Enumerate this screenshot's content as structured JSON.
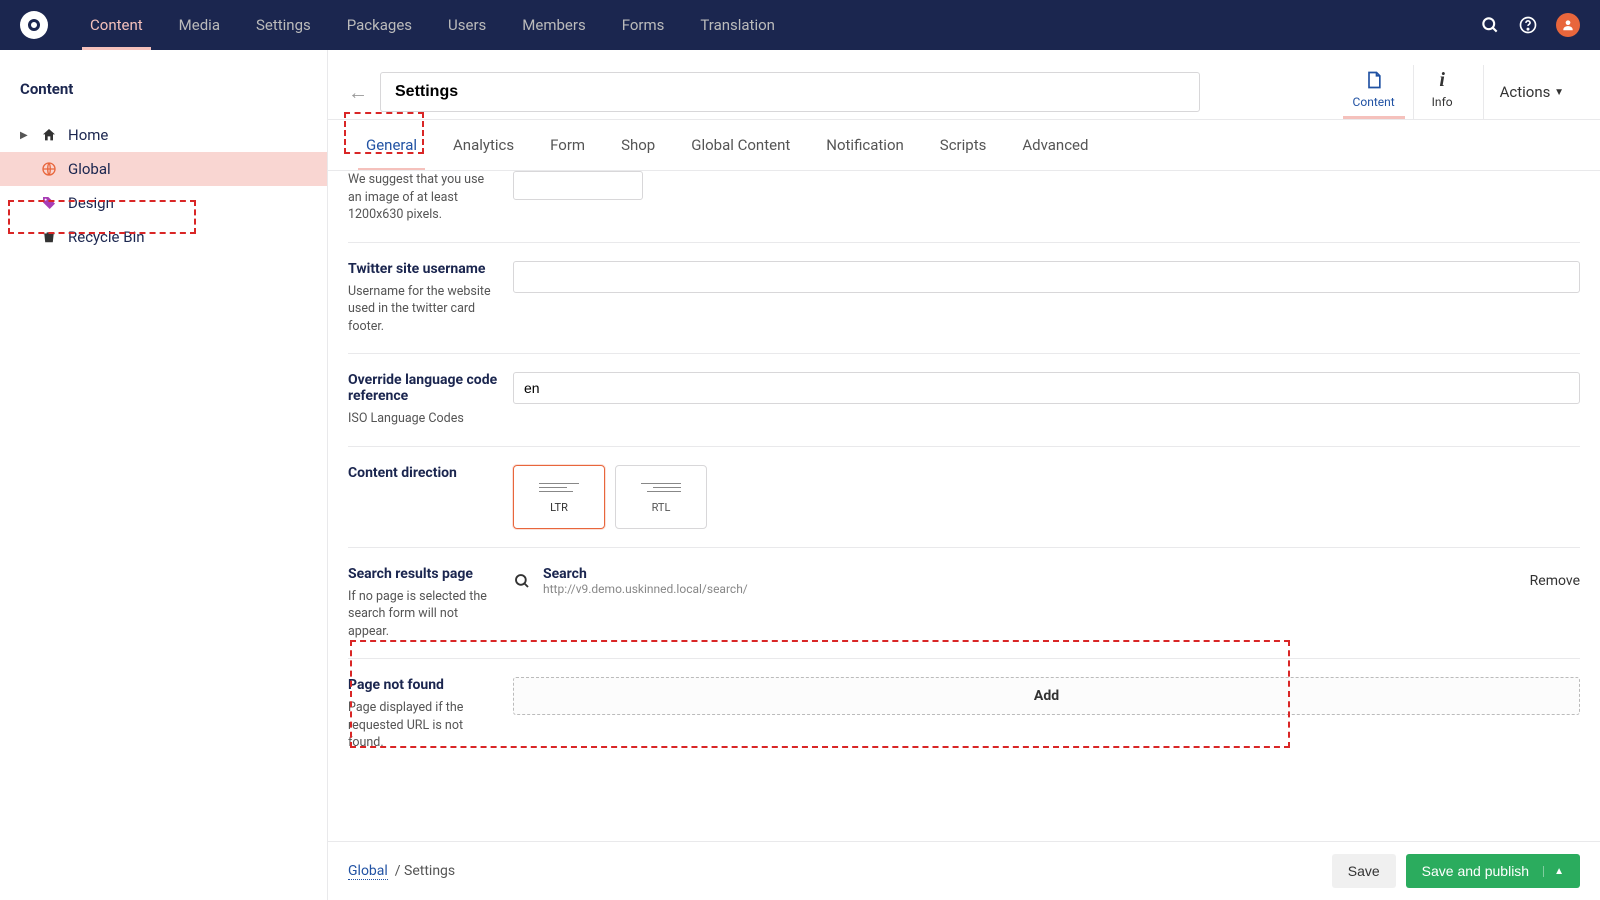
{
  "topnav": {
    "items": [
      "Content",
      "Media",
      "Settings",
      "Packages",
      "Users",
      "Members",
      "Forms",
      "Translation"
    ],
    "active": 0
  },
  "sidebar": {
    "title": "Content",
    "items": [
      {
        "label": "Home",
        "icon": "home"
      },
      {
        "label": "Global",
        "icon": "globe",
        "active": true
      },
      {
        "label": "Design",
        "icon": "tag"
      },
      {
        "label": "Recycle Bin",
        "icon": "trash"
      }
    ]
  },
  "editor": {
    "name": "Settings",
    "apps": [
      {
        "label": "Content",
        "icon": "file",
        "active": true
      },
      {
        "label": "Info",
        "icon": "info"
      }
    ],
    "actions_label": "Actions"
  },
  "tabs": {
    "items": [
      "General",
      "Analytics",
      "Form",
      "Shop",
      "Global Content",
      "Notification",
      "Scripts",
      "Advanced"
    ],
    "active": 0
  },
  "props": {
    "image_hint": "We suggest that you use an image of at least 1200x630 pixels.",
    "twitter_label": "Twitter site username",
    "twitter_desc": "Username for the website used in the twitter card footer.",
    "twitter_value": "",
    "lang_label": "Override language code reference",
    "lang_desc": "ISO Language Codes",
    "lang_value": "en",
    "dir_label": "Content direction",
    "dir_ltr": "LTR",
    "dir_rtl": "RTL",
    "search_label": "Search results page",
    "search_desc": "If no page is selected the search form will not appear.",
    "search_picked_title": "Search",
    "search_picked_url": "http://v9.demo.uskinned.local/search/",
    "remove_label": "Remove",
    "pnf_label": "Page not found",
    "pnf_desc": "Page displayed if the requested URL is not found.",
    "add_label": "Add"
  },
  "footer": {
    "crumb_parent": "Global",
    "crumb_current": "Settings",
    "save": "Save",
    "publish": "Save and publish"
  }
}
